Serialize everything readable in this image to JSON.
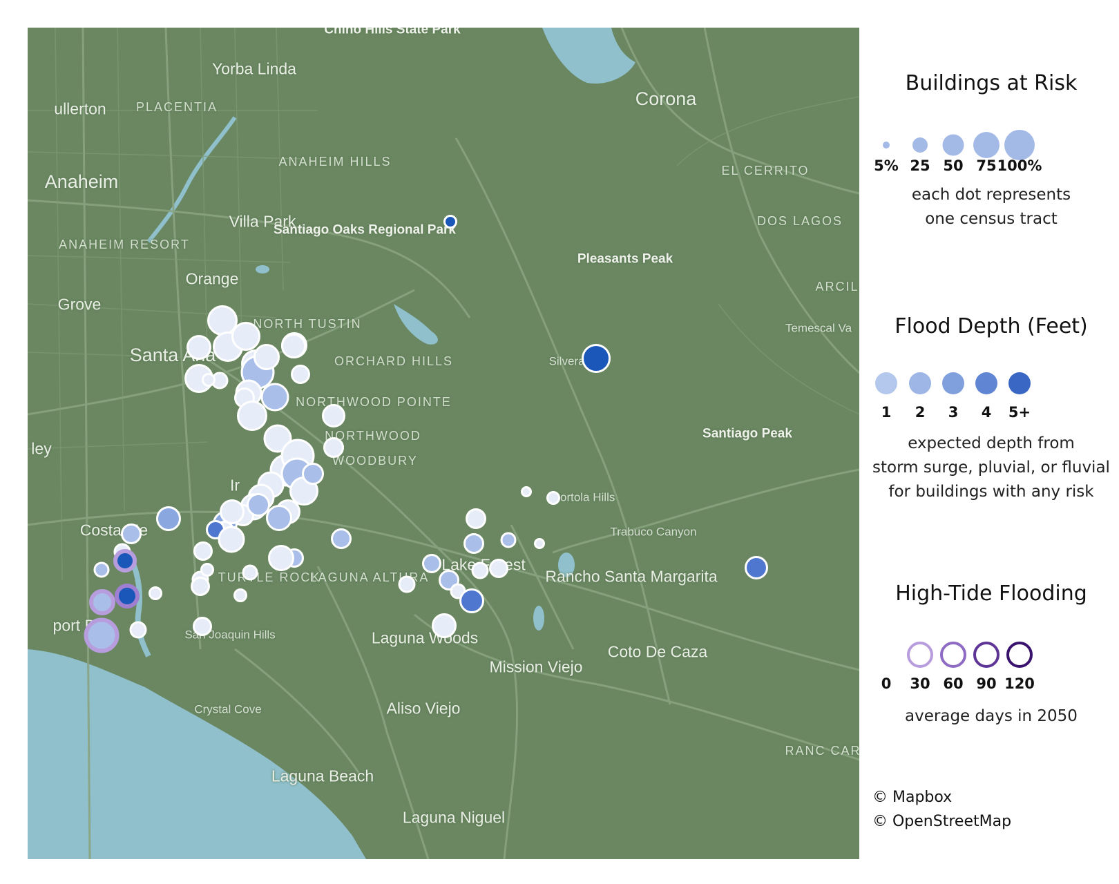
{
  "map": {
    "colors": {
      "land": "#6a8762",
      "water": "#8fc0cb",
      "road": "#8aa380"
    },
    "place_labels": [
      {
        "text": "Chino Hills State Park",
        "cls": "park"
      },
      {
        "text": "Yorba Linda",
        "cls": "mid"
      },
      {
        "text": "ullerton",
        "cls": "mid"
      },
      {
        "text": "PLACENTIA",
        "cls": "caps"
      },
      {
        "text": "Corona",
        "cls": "big"
      },
      {
        "text": "ANAHEIM HILLS",
        "cls": "caps"
      },
      {
        "text": "Anaheim",
        "cls": "big"
      },
      {
        "text": "EL CERRITO",
        "cls": "caps"
      },
      {
        "text": "Villa Park",
        "cls": "mid"
      },
      {
        "text": "Santiago Oaks Regional Park",
        "cls": "park"
      },
      {
        "text": "DOS LAGOS",
        "cls": "caps"
      },
      {
        "text": "ANAHEIM RESORT",
        "cls": "caps"
      },
      {
        "text": "Pleasants Peak",
        "cls": "park"
      },
      {
        "text": "Orange",
        "cls": "mid"
      },
      {
        "text": "ARCIL",
        "cls": "caps"
      },
      {
        "text": "Grove",
        "cls": "mid"
      },
      {
        "text": "NORTH TUSTIN",
        "cls": "caps"
      },
      {
        "text": "Temescal Va",
        "cls": "small"
      },
      {
        "text": "Santa Ana",
        "cls": "big"
      },
      {
        "text": "ORCHARD HILLS",
        "cls": "caps"
      },
      {
        "text": "Silverado",
        "cls": "small"
      },
      {
        "text": "NORTHWOOD POINTE",
        "cls": "caps"
      },
      {
        "text": "Santiago Peak",
        "cls": "park"
      },
      {
        "text": "NORTHWOOD",
        "cls": "caps"
      },
      {
        "text": "ley",
        "cls": "mid"
      },
      {
        "text": "WOODBURY",
        "cls": "caps"
      },
      {
        "text": "Ir",
        "cls": "mid"
      },
      {
        "text": "Portola Hills",
        "cls": "small"
      },
      {
        "text": "Costa Me",
        "cls": "mid"
      },
      {
        "text": "Trabuco Canyon",
        "cls": "small"
      },
      {
        "text": "TURTLE ROCK",
        "cls": "caps"
      },
      {
        "text": "LAGUNA ALTURA",
        "cls": "caps"
      },
      {
        "text": "Lake Forest",
        "cls": "mid"
      },
      {
        "text": "Rancho Santa Margarita",
        "cls": "mid"
      },
      {
        "text": "port Bea",
        "cls": "mid"
      },
      {
        "text": "San Joaquin Hills",
        "cls": "small"
      },
      {
        "text": "Laguna Woods",
        "cls": "mid"
      },
      {
        "text": "Coto De Caza",
        "cls": "mid"
      },
      {
        "text": "Mission Viejo",
        "cls": "mid"
      },
      {
        "text": "RANC CARI",
        "cls": "caps"
      },
      {
        "text": "Crystal Cove",
        "cls": "small"
      },
      {
        "text": "Aliso Viejo",
        "cls": "mid"
      },
      {
        "text": "Laguna Beach",
        "cls": "mid"
      },
      {
        "text": "Laguna Niguel",
        "cls": "mid"
      }
    ],
    "tracts": [
      {
        "risk": 30,
        "depth": 1
      },
      {
        "risk": 30,
        "depth": 1
      },
      {
        "risk": 28,
        "depth": 1
      },
      {
        "risk": 20,
        "depth": 1
      },
      {
        "risk": 28,
        "depth": 1
      },
      {
        "risk": 28,
        "depth": 1
      },
      {
        "risk": 22,
        "depth": 1
      },
      {
        "risk": 10,
        "depth": 1
      },
      {
        "risk": 38,
        "depth": 2
      },
      {
        "risk": 22,
        "depth": 1
      },
      {
        "risk": 24,
        "depth": 1
      },
      {
        "risk": 12,
        "depth": 1
      },
      {
        "risk": 6,
        "depth": 1
      },
      {
        "risk": 26,
        "depth": 2
      },
      {
        "risk": 14,
        "depth": 1
      },
      {
        "risk": 30,
        "depth": 1
      },
      {
        "risk": 20,
        "depth": 1
      },
      {
        "risk": 26,
        "depth": 1
      },
      {
        "risk": 18,
        "depth": 1
      },
      {
        "risk": 34,
        "depth": 1
      },
      {
        "risk": 38,
        "depth": 1
      },
      {
        "risk": 14,
        "depth": 1
      },
      {
        "risk": 34,
        "depth": 2
      },
      {
        "risk": 28,
        "depth": 1
      },
      {
        "risk": 24,
        "depth": 1
      },
      {
        "risk": 20,
        "depth": 1
      },
      {
        "risk": 24,
        "depth": 1
      },
      {
        "risk": 16,
        "depth": 2
      },
      {
        "risk": 24,
        "depth": 1
      },
      {
        "risk": 16,
        "depth": 1
      },
      {
        "risk": 20,
        "depth": 3
      },
      {
        "risk": 12,
        "depth": 1
      },
      {
        "risk": 22,
        "depth": 2
      },
      {
        "risk": 12,
        "depth": 4
      },
      {
        "risk": 18,
        "depth": 2
      },
      {
        "risk": 14,
        "depth": 2
      },
      {
        "risk": 10,
        "depth": 1
      },
      {
        "risk": 20,
        "depth": 1
      },
      {
        "risk": 10,
        "depth": 1
      },
      {
        "risk": 12,
        "depth": 1
      },
      {
        "risk": 6,
        "depth": 1
      },
      {
        "risk": 24,
        "depth": 1
      },
      {
        "risk": 12,
        "depth": 1
      },
      {
        "risk": 8,
        "depth": 1
      },
      {
        "risk": 6,
        "depth": 1
      },
      {
        "risk": 6,
        "depth": 5
      },
      {
        "risk": 28,
        "depth": 5
      },
      {
        "risk": 18,
        "depth": 4
      },
      {
        "risk": 4,
        "depth": 1
      },
      {
        "risk": 6,
        "depth": 1
      },
      {
        "risk": 14,
        "depth": 1
      },
      {
        "risk": 14,
        "depth": 2
      },
      {
        "risk": 8,
        "depth": 2
      },
      {
        "risk": 20,
        "depth": 3
      },
      {
        "risk": 12,
        "depth": 2
      },
      {
        "risk": 14,
        "depth": 2
      },
      {
        "risk": 12,
        "depth": 1
      },
      {
        "risk": 10,
        "depth": 1
      },
      {
        "risk": 8,
        "depth": 1
      },
      {
        "risk": 10,
        "depth": 1
      },
      {
        "risk": 20,
        "depth": 4
      },
      {
        "risk": 20,
        "depth": 1
      },
      {
        "risk": 4,
        "depth": 1
      },
      {
        "risk": 8,
        "depth": 2
      },
      {
        "risk": 14,
        "depth": 2
      },
      {
        "risk": 12,
        "depth": 2
      },
      {
        "risk": 22,
        "depth": 1
      },
      {
        "risk": 12,
        "depth": 1
      },
      {
        "risk": 12,
        "depth": 5,
        "tide": 30
      },
      {
        "risk": 16,
        "depth": 2,
        "tide": 30
      },
      {
        "risk": 14,
        "depth": 5,
        "tide": 60
      },
      {
        "risk": 32,
        "depth": 2,
        "tide": 30
      },
      {
        "risk": 6,
        "depth": 1
      },
      {
        "risk": 10,
        "depth": 1
      }
    ]
  },
  "legend": {
    "risk": {
      "title": "Buildings at Risk",
      "items": [
        {
          "label": "5%",
          "value": 5
        },
        {
          "label": "25",
          "value": 25
        },
        {
          "label": "50",
          "value": 50
        },
        {
          "label": "75",
          "value": 75
        },
        {
          "label": "100%",
          "value": 100
        }
      ],
      "desc_lines": [
        "each dot represents",
        "one census tract"
      ]
    },
    "depth": {
      "title": "Flood Depth (Feet)",
      "items": [
        {
          "label": "1",
          "color": "#b3c8ec"
        },
        {
          "label": "2",
          "color": "#9db6e6"
        },
        {
          "label": "3",
          "color": "#7f9fdd"
        },
        {
          "label": "4",
          "color": "#5f85d3"
        },
        {
          "label": "5+",
          "color": "#3a67c4"
        }
      ],
      "desc_lines": [
        "expected depth from",
        "storm surge, pluvial, or fluvial",
        "for buildings with any risk"
      ]
    },
    "tide": {
      "title": "High-Tide Flooding",
      "items": [
        {
          "label": "0",
          "color": ""
        },
        {
          "label": "30",
          "color": "#b79ddd"
        },
        {
          "label": "60",
          "color": "#8f6cc3"
        },
        {
          "label": "90",
          "color": "#5e3597"
        },
        {
          "label": "120",
          "color": "#3a136e"
        }
      ],
      "desc_lines": [
        "average days in 2050"
      ]
    },
    "map_depth_colors": {
      "1": "#e6ecf8",
      "2": "#a9bee8",
      "3": "#8aa7e0",
      "4": "#4f77cf",
      "5": "#1a57b8"
    },
    "map_tide_colors": {
      "30": "#b79ddd",
      "60": "#a07fd0"
    }
  },
  "credits": [
    "© Mapbox",
    "© OpenStreetMap"
  ]
}
